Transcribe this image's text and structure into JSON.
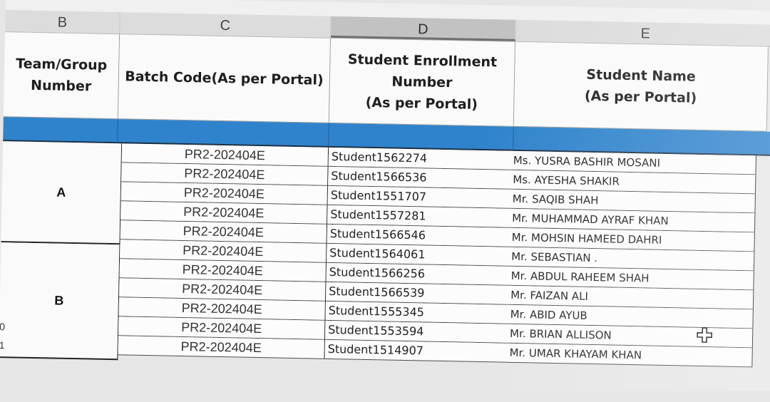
{
  "columns": [
    "B",
    "C",
    "D",
    "E"
  ],
  "headers": {
    "team_group": [
      "Team/Group",
      "Number"
    ],
    "batch_code": [
      "Batch Code(As per Portal)"
    ],
    "enrollment": [
      "Student Enrollment",
      "Number",
      "(As per Portal)"
    ],
    "student_name": [
      "Student Name",
      "(As per Portal)"
    ]
  },
  "groups": [
    {
      "label": "A"
    },
    {
      "label": "B"
    }
  ],
  "row_numbers": [
    "0",
    "1"
  ],
  "rows": [
    {
      "batch": "PR2-202404E",
      "enrollment": "Student1562274",
      "name": "Ms. YUSRA BASHIR MOSANI"
    },
    {
      "batch": "PR2-202404E",
      "enrollment": "Student1566536",
      "name": "Ms. AYESHA SHAKIR"
    },
    {
      "batch": "PR2-202404E",
      "enrollment": "Student1551707",
      "name": "Mr. SAQIB SHAH"
    },
    {
      "batch": "PR2-202404E",
      "enrollment": "Student1557281",
      "name": "Mr. MUHAMMAD AYRAF KHAN"
    },
    {
      "batch": "PR2-202404E",
      "enrollment": "Student1566546",
      "name": "Mr. MOHSIN HAMEED DAHRI"
    },
    {
      "batch": "PR2-202404E",
      "enrollment": "Student1564061",
      "name": "Mr. SEBASTIAN ."
    },
    {
      "batch": "PR2-202404E",
      "enrollment": "Student1566256",
      "name": "Mr. ABDUL RAHEEM SHAH"
    },
    {
      "batch": "PR2-202404E",
      "enrollment": "Student1566539",
      "name": "Mr. FAIZAN ALI"
    },
    {
      "batch": "PR2-202404E",
      "enrollment": "Student1555345",
      "name": "Mr. ABID AYUB"
    },
    {
      "batch": "PR2-202404E",
      "enrollment": "Student1553594",
      "name": "Mr. BRIAN ALLISON"
    },
    {
      "batch": "PR2-202404E",
      "enrollment": "Student1514907",
      "name": "Mr. UMAR KHAYAM KHAN"
    }
  ],
  "cursor_icon": "plus-cross-cursor-icon",
  "colors": {
    "blue_band": "#2f83cc"
  }
}
